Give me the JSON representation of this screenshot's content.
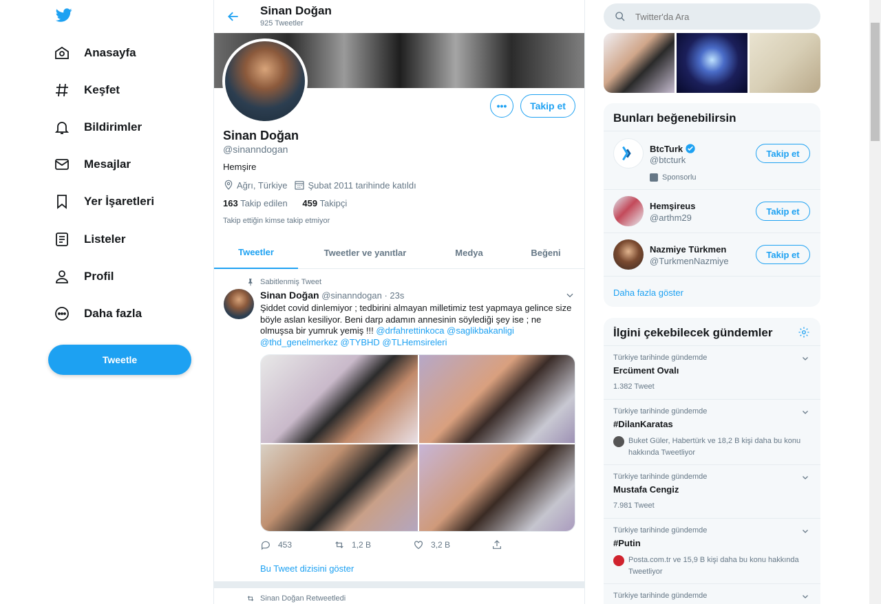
{
  "nav": {
    "items": [
      {
        "label": "Anasayfa",
        "icon": "home-icon"
      },
      {
        "label": "Keşfet",
        "icon": "hashtag-icon"
      },
      {
        "label": "Bildirimler",
        "icon": "bell-icon"
      },
      {
        "label": "Mesajlar",
        "icon": "mail-icon"
      },
      {
        "label": "Yer İşaretleri",
        "icon": "bookmark-icon"
      },
      {
        "label": "Listeler",
        "icon": "list-icon"
      },
      {
        "label": "Profil",
        "icon": "person-icon"
      },
      {
        "label": "Daha fazla",
        "icon": "more-circle-icon"
      }
    ],
    "tweet_button": "Tweetle"
  },
  "header": {
    "name": "Sinan Doğan",
    "tweet_count": "925 Tweetler"
  },
  "profile": {
    "name": "Sinan Doğan",
    "handle": "@sinanndogan",
    "bio": "Hemşire",
    "location": "Ağrı, Türkiye",
    "joined": "Şubat 2011 tarihinde katıldı",
    "following_count": "163",
    "following_label": "Takip edilen",
    "followers_count": "459",
    "followers_label": "Takipçi",
    "note": "Takip ettiğin kimse takip etmiyor",
    "follow_button": "Takip et",
    "more_button": "•••"
  },
  "tabs": [
    "Tweetler",
    "Tweetler ve yanıtlar",
    "Medya",
    "Beğeni"
  ],
  "tweet": {
    "pinned_label": "Sabitlenmiş Tweet",
    "author": "Sinan Doğan",
    "handle_time": "@sinanndogan · 23s",
    "text": "Şiddet covid dinlemiyor ; tedbirini almayan milletimiz test yapmaya gelince size böyle aslan kesiliyor. Beni darp adamın annesinin söylediği şey ise ; ne olmuşsa bir yumruk yemiş !!!",
    "mentions_1": "@drfahrettinkoca @saglikbakanligi",
    "mentions_2": "@thd_genelmerkez @TYBHD @TLHemsireleri",
    "replies": "453",
    "retweets": "1,2 B",
    "likes": "3,2 B",
    "show_thread": "Bu Tweet dizisini göster"
  },
  "retweet_note": "Sinan Doğan Retweetledi",
  "search": {
    "placeholder": "Twitter'da Ara"
  },
  "suggestions": {
    "title": "Bunları beğenebilirsin",
    "items": [
      {
        "name": "BtcTurk",
        "handle": "@btcturk",
        "button": "Takip et",
        "sponsored": "Sponsorlu"
      },
      {
        "name": "Hemşireus",
        "handle": "@arthm29",
        "button": "Takip et"
      },
      {
        "name": "Nazmiye Türkmen",
        "handle": "@TurkmenNazmiye",
        "button": "Takip et"
      }
    ],
    "more": "Daha fazla göster"
  },
  "trends": {
    "title": "İlgini çekebilecek gündemler",
    "items": [
      {
        "context": "Türkiye tarihinde gündemde",
        "name": "Ercüment Ovalı",
        "sub": "1.382 Tweet"
      },
      {
        "context": "Türkiye tarihinde gündemde",
        "name": "#DilanKaratas",
        "people": "Buket Güler, Habertürk ve 18,2 B kişi daha bu konu hakkında Tweetliyor"
      },
      {
        "context": "Türkiye tarihinde gündemde",
        "name": "Mustafa Cengiz",
        "sub": "7.981 Tweet"
      },
      {
        "context": "Türkiye tarihinde gündemde",
        "name": "#Putin",
        "people": "Posta.com.tr ve 15,9 B kişi daha bu konu hakkında Tweetliyor"
      },
      {
        "context": "Türkiye tarihinde gündemde"
      }
    ]
  },
  "colors": {
    "accent": "#1da1f2",
    "text": "#14171a",
    "muted": "#657786",
    "border": "#e6ecf0"
  }
}
